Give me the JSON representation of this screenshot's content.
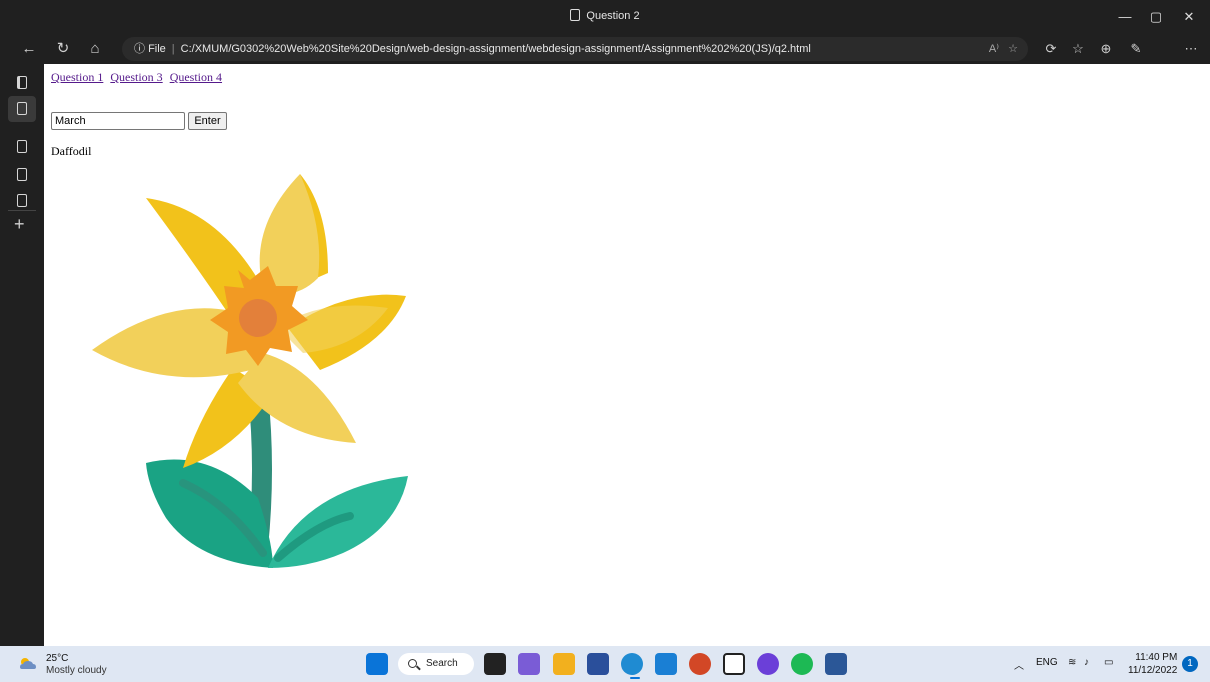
{
  "window": {
    "title": "Question 2"
  },
  "address_bar": {
    "scheme_label": "File",
    "url": "C:/XMUM/G0302%20Web%20Site%20Design/web-design-assignment/webdesign-assignment/Assignment%202%20(JS)/q2.html",
    "read_aloud": "A⁾"
  },
  "page": {
    "links": [
      "Question 1",
      "Question 3",
      "Question 4"
    ],
    "month_input_value": "March",
    "enter_label": "Enter",
    "flower_name": "Daffodil"
  },
  "taskbar": {
    "weather_temp": "25°C",
    "weather_condition": "Mostly cloudy",
    "search_label": "Search",
    "lang": "ENG",
    "time": "11:40 PM",
    "date": "11/12/2022",
    "notification_count": "1"
  },
  "colors": {
    "petal_dark": "#f2c21b",
    "petal_light": "#f2d05a",
    "trumpet": "#f29a23",
    "trumpet_center": "#e3803a",
    "stem": "#2f8d7a",
    "leaf_dark": "#1aa384",
    "leaf_light": "#2bb899"
  }
}
